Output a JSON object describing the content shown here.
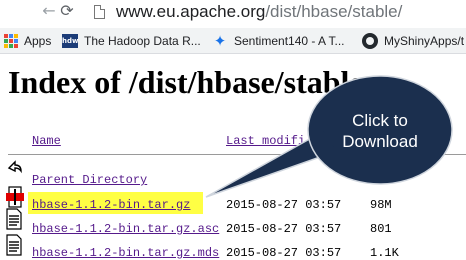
{
  "browser": {
    "url_host": "www.eu.apache.org",
    "url_path": "/dist/hbase/stable/"
  },
  "bookmarks": [
    {
      "label": "Apps",
      "icon": "apps-grid-icon"
    },
    {
      "label": "The Hadoop Data R...",
      "icon": "hadoop-summit-icon"
    },
    {
      "label": "Sentiment140 - A T...",
      "icon": "sentiment-bird-icon"
    },
    {
      "label": "MyShinyApps/t",
      "icon": "github-icon"
    }
  ],
  "page": {
    "title": "Index of /dist/hbase/stable",
    "columns": {
      "name": "Name",
      "last_modified": "Last modifi"
    },
    "parent_link": "Parent Directory",
    "files": [
      {
        "name": "hbase-1.1.2-bin.tar.gz",
        "date": "2015-08-27 03:57",
        "size": "98M",
        "icon": "archive-file-icon",
        "highlighted": true
      },
      {
        "name": "hbase-1.1.2-bin.tar.gz.asc",
        "date": "2015-08-27 03:57",
        "size": "801",
        "icon": "text-file-icon"
      },
      {
        "name": "hbase-1.1.2-bin.tar.gz.mds",
        "date": "2015-08-27 03:57",
        "size": "1.1K",
        "icon": "text-file-icon"
      }
    ]
  },
  "callout": {
    "line1": "Click to",
    "line2": "Download",
    "color": "#1b2f4e"
  },
  "colors": {
    "highlight": "#ffff44",
    "link_visited": "#551a8b",
    "bookmarks_bar": "#f1f3f4"
  }
}
